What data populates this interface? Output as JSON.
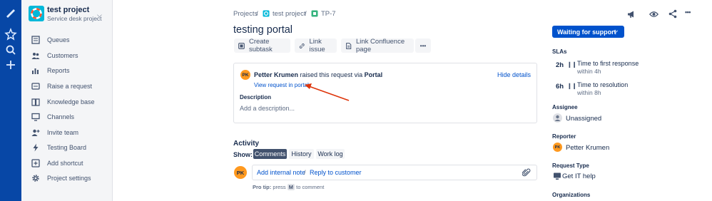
{
  "project": {
    "name": "test project",
    "type": "Service desk project"
  },
  "nav": [
    {
      "label": "Queues"
    },
    {
      "label": "Customers"
    },
    {
      "label": "Reports"
    },
    {
      "label": "Raise a request"
    },
    {
      "label": "Knowledge base"
    },
    {
      "label": "Channels"
    },
    {
      "label": "Invite team"
    },
    {
      "label": "Testing Board"
    },
    {
      "label": "Add shortcut"
    },
    {
      "label": "Project settings"
    }
  ],
  "breadcrumb": {
    "projects": "Projects",
    "sep": "/",
    "project": "test project",
    "issue": "TP-7"
  },
  "issue": {
    "title": "testing portal"
  },
  "toolbar": {
    "create_subtask": "Create subtask",
    "link_issue": "Link issue",
    "link_confluence": "Link Confluence page",
    "more": "•••"
  },
  "request": {
    "reporter": "Petter Krumen",
    "raised_text": "raised this request via",
    "channel": "Portal",
    "hide_details": "Hide details",
    "view_portal": "View request in portal",
    "description_label": "Description",
    "description_placeholder": "Add a description..."
  },
  "activity": {
    "heading": "Activity",
    "show_label": "Show:",
    "tabs": [
      "Comments",
      "History",
      "Work log"
    ],
    "add_internal_note": "Add internal note",
    "sep": "/",
    "reply_to_customer": "Reply to customer",
    "pro_tip_label": "Pro tip:",
    "pro_tip_press": "press",
    "pro_tip_key": "M",
    "pro_tip_rest": "to comment"
  },
  "right": {
    "status_button": "Waiting for support",
    "slas_heading": "SLAs",
    "slas": [
      {
        "time": "2h",
        "name": "Time to first response",
        "goal": "within 4h"
      },
      {
        "time": "6h",
        "name": "Time to resolution",
        "goal": "within 8h"
      }
    ],
    "assignee_heading": "Assignee",
    "assignee": "Unassigned",
    "reporter_heading": "Reporter",
    "reporter": "Petter Krumen",
    "request_type_heading": "Request Type",
    "request_type": "Get IT help",
    "organizations_heading": "Organizations"
  },
  "avatar_initials": "PK",
  "colors": {
    "rail": "#0747a6",
    "primary": "#0052cc",
    "avatar": "#ff991f",
    "annotation_arrow": "#de350b"
  }
}
